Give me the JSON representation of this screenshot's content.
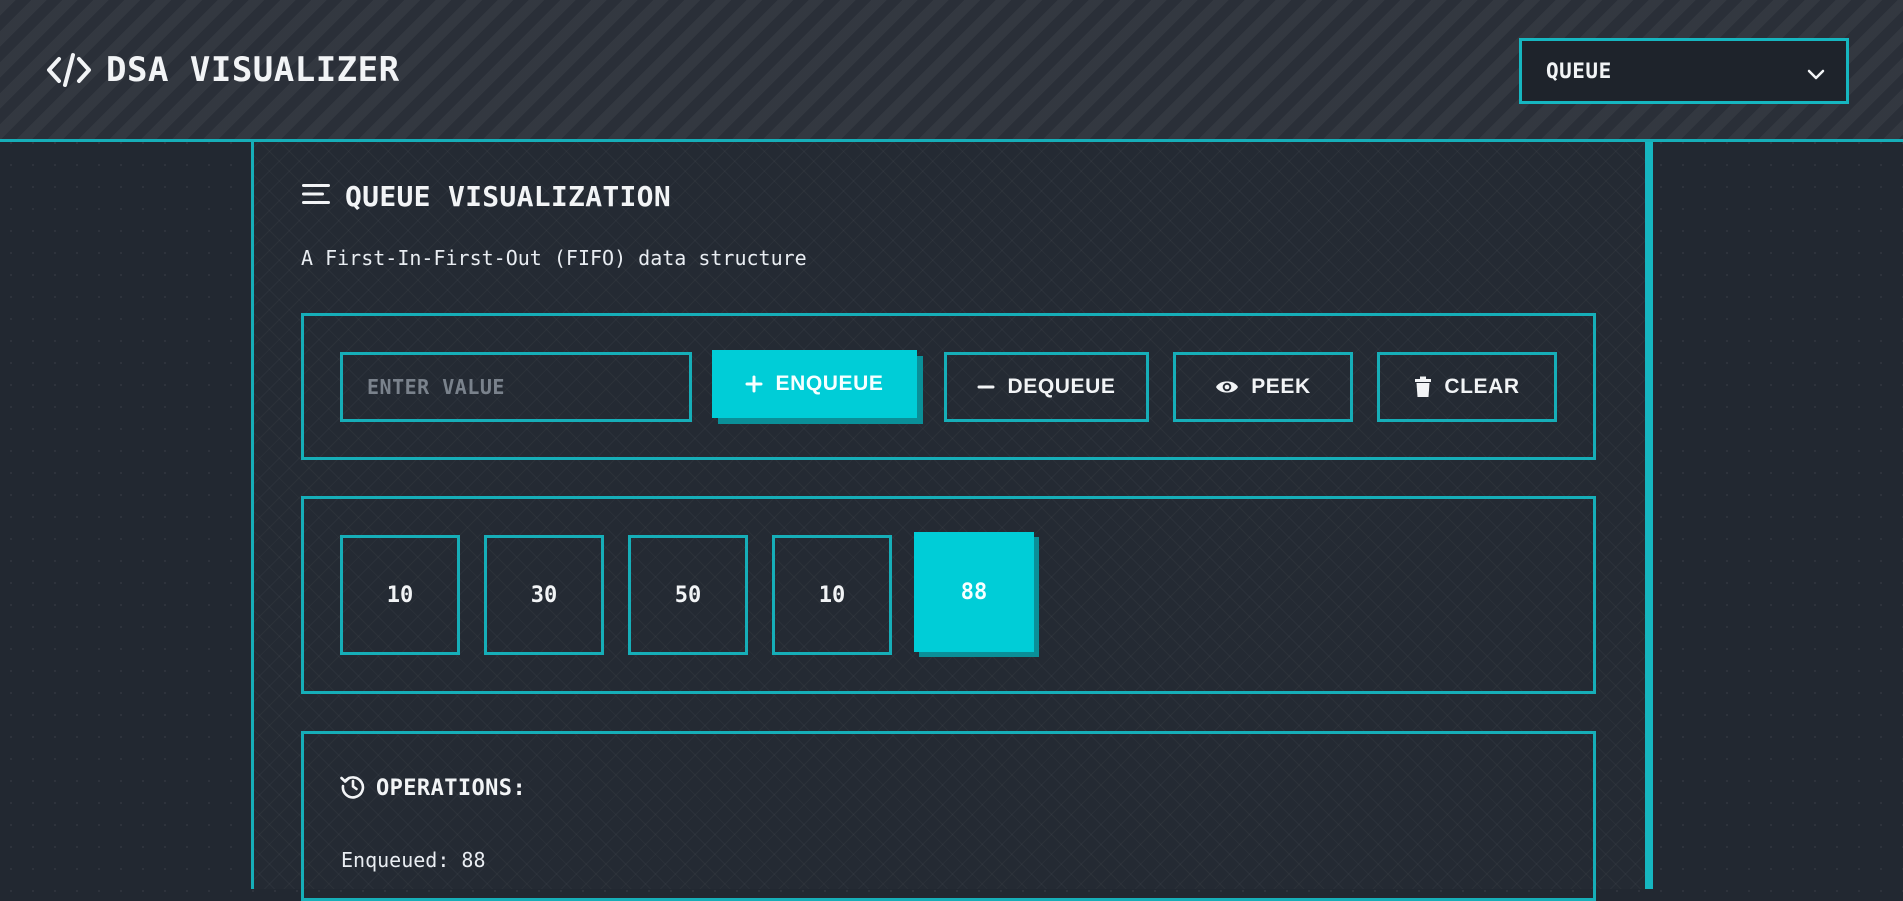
{
  "header": {
    "logo_label": "DSA VISUALIZER",
    "structure_select": {
      "value": "QUEUE"
    }
  },
  "main": {
    "title": "QUEUE VISUALIZATION",
    "subtitle": "A First-In-First-Out (FIFO) data structure",
    "controls": {
      "value_placeholder": "ENTER VALUE",
      "enqueue_label": "ENQUEUE",
      "dequeue_label": "DEQUEUE",
      "peek_label": "PEEK",
      "clear_label": "CLEAR"
    },
    "queue": {
      "items": [
        "10",
        "30",
        "50",
        "10",
        "88"
      ]
    },
    "operations": {
      "title": "OPERATIONS:",
      "entries": [
        "Enqueued: 88"
      ]
    }
  },
  "colors": {
    "accent": "#00cdd7",
    "accent_border": "#16aeb8",
    "background": "#222831"
  },
  "icons": {
    "logo": "code-icon",
    "title": "list-icon",
    "select": "chevron-down-icon",
    "enqueue": "plus-icon",
    "dequeue": "minus-icon",
    "peek": "eye-icon",
    "clear": "trash-icon",
    "operations": "history-icon"
  }
}
